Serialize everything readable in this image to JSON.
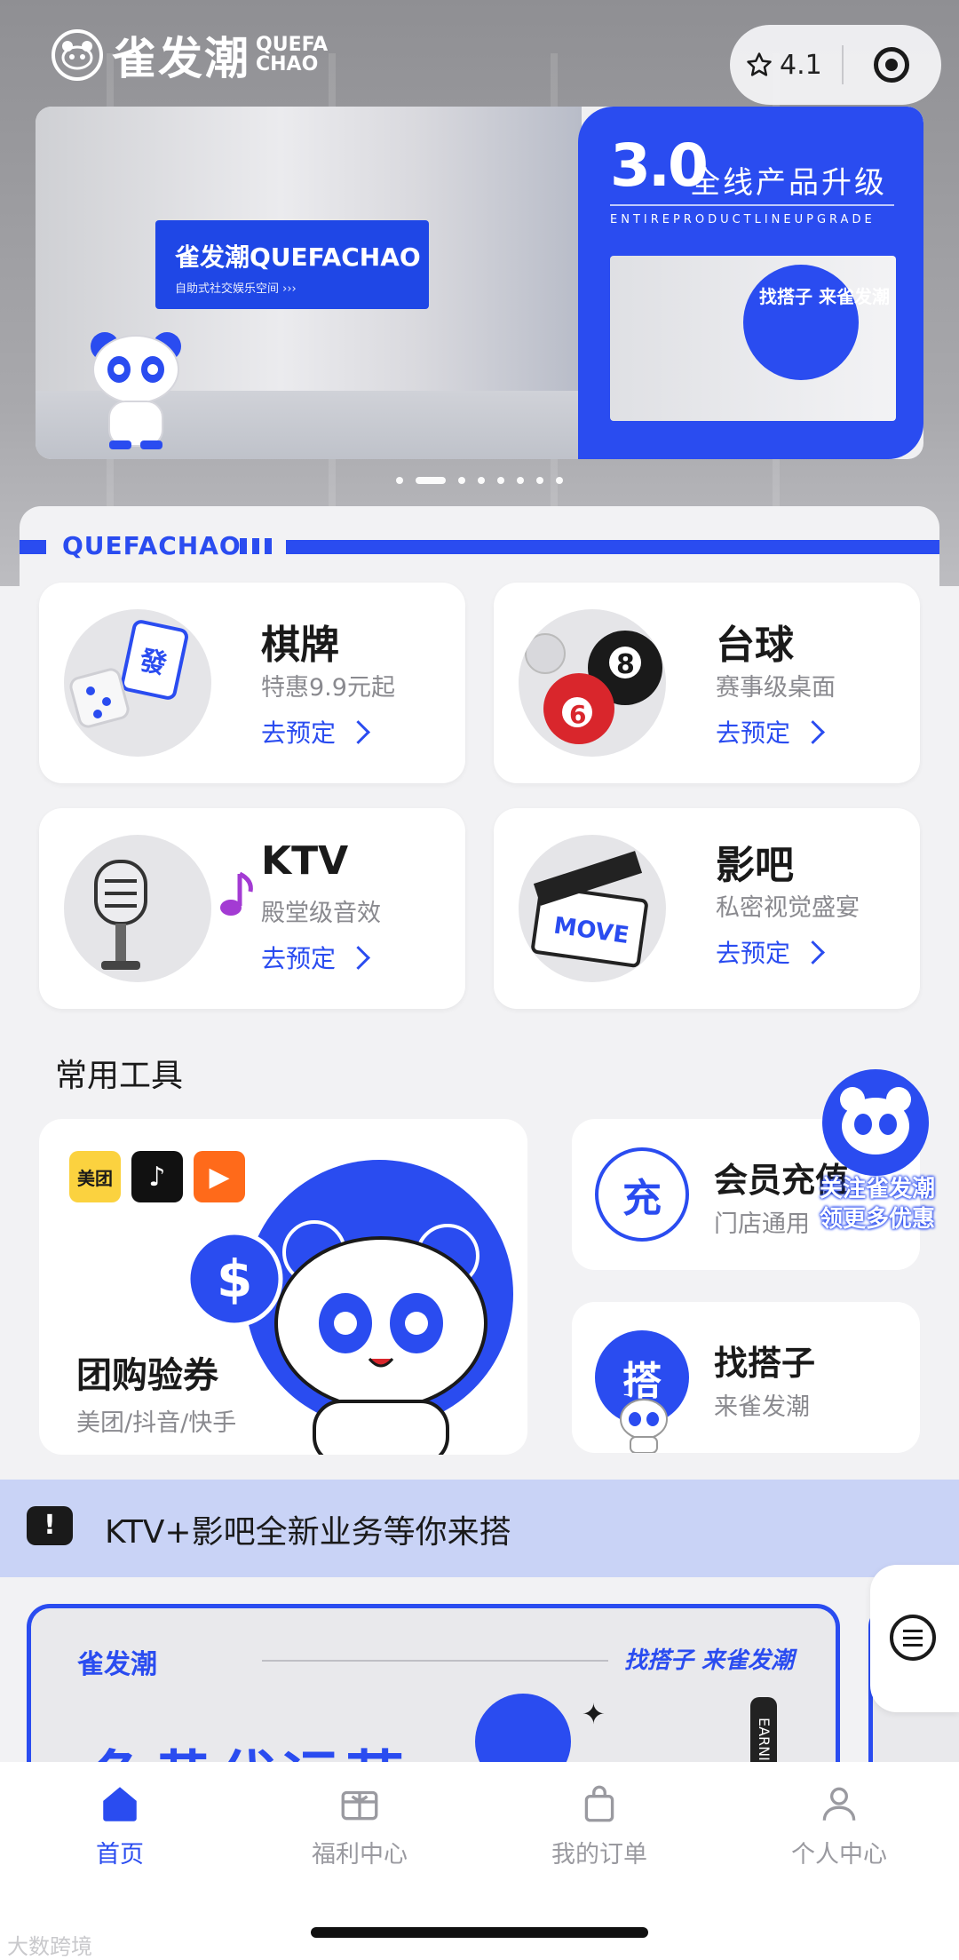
{
  "header": {
    "brand_cn": "雀发潮",
    "brand_en_line1": "QUEFA",
    "brand_en_line2": "CHAO",
    "rating": "4.1"
  },
  "banner": {
    "sign_text": "雀发潮QUEFACHAO",
    "promo_big": "3.0",
    "promo_title": "全线产品升级",
    "promo_sub": "ENTIREPRODUCTLINEUPGRADE",
    "promo_pic_text": "找搭子 来雀发潮",
    "dots_count": 8,
    "active_dot": 1
  },
  "brand_strip": "QUEFACHAO",
  "services": [
    {
      "title": "棋牌",
      "desc": "特惠9.9元起",
      "action": "去预定",
      "icon": "mahjong-dice-icon"
    },
    {
      "title": "台球",
      "desc": "赛事级桌面",
      "action": "去预定",
      "icon": "billiard-balls-icon"
    },
    {
      "title": "KTV",
      "desc": "殿堂级音效",
      "action": "去预定",
      "icon": "microphone-icon"
    },
    {
      "title": "影吧",
      "desc": "私密视觉盛宴",
      "action": "去预定",
      "icon": "clapperboard-icon"
    }
  ],
  "tools_section_title": "常用工具",
  "tools": {
    "group_buy": {
      "title": "团购验券",
      "desc": "美团/抖音/快手",
      "apps": [
        "美团",
        "抖音",
        "快手"
      ]
    },
    "recharge": {
      "badge": "充",
      "title": "会员充值",
      "desc": "门店通用"
    },
    "partner": {
      "badge": "搭",
      "title": "找搭子",
      "desc": "来雀发潮"
    }
  },
  "follow_float": {
    "line1": "关注雀发潮",
    "line2": "领更多优惠"
  },
  "notice": {
    "icon": "!",
    "text": "KTV+影吧全新业务等你来搭"
  },
  "lower_banner": {
    "brand": "雀发潮",
    "slogan": "找搭子 来雀发潮",
    "big_text": "鱼黄代运营",
    "vertical_tag": "EARNING"
  },
  "tabbar": [
    {
      "label": "首页",
      "icon": "home-icon",
      "active": true
    },
    {
      "label": "福利中心",
      "icon": "gift-icon",
      "active": false
    },
    {
      "label": "我的订单",
      "icon": "bag-icon",
      "active": false
    },
    {
      "label": "个人中心",
      "icon": "user-icon",
      "active": false
    }
  ],
  "watermark": "大数跨境",
  "colors": {
    "accent": "#2a4cf0",
    "notice_bg": "#c9d3f6"
  }
}
